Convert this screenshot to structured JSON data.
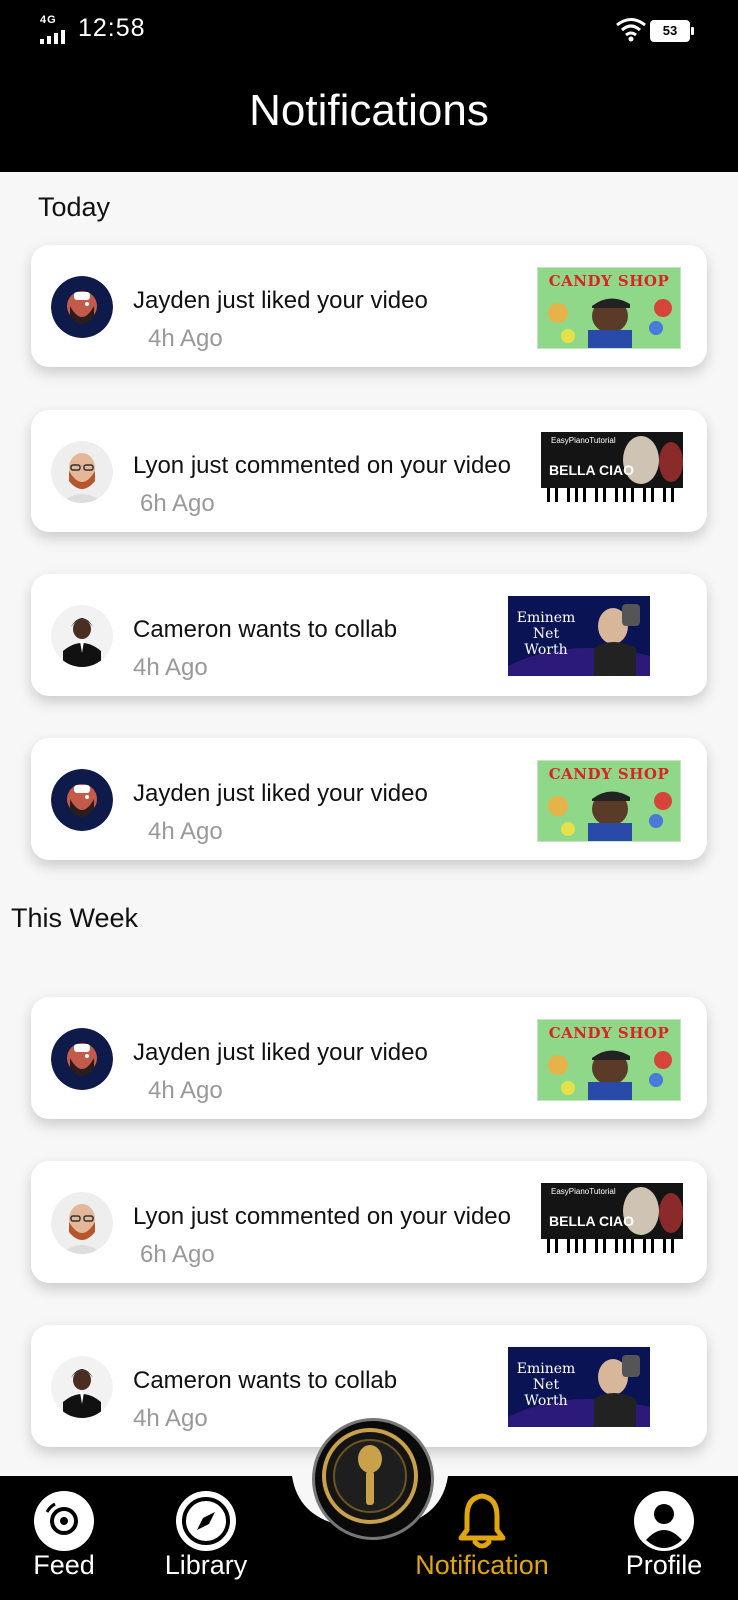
{
  "status_bar": {
    "network": "4G",
    "time": "12:58",
    "battery": "53"
  },
  "header": {
    "title": "Notifications"
  },
  "sections": [
    {
      "title": "Today",
      "items": [
        {
          "message": "Jayden just liked your video",
          "time": "4h Ago",
          "avatar": "bearded-man-illustration-avatar",
          "thumbnail": "candy-shop"
        },
        {
          "message": "Lyon just commented on your video",
          "time": "6h Ago",
          "avatar": "red-haired-man-photo-avatar",
          "thumbnail": "bella-ciao"
        },
        {
          "message": "Cameron wants to collab",
          "time": "4h Ago",
          "avatar": "man-in-suit-photo-avatar",
          "thumbnail": "eminem-net-worth"
        },
        {
          "message": "Jayden just liked your video",
          "time": "4h Ago",
          "avatar": "bearded-man-illustration-avatar",
          "thumbnail": "candy-shop"
        }
      ]
    },
    {
      "title": "This Week",
      "items": [
        {
          "message": "Jayden just liked your video",
          "time": "4h Ago",
          "avatar": "bearded-man-illustration-avatar",
          "thumbnail": "candy-shop"
        },
        {
          "message": "Lyon just commented on your video",
          "time": "6h Ago",
          "avatar": "red-haired-man-photo-avatar",
          "thumbnail": "bella-ciao"
        },
        {
          "message": "Cameron wants to collab",
          "time": "4h Ago",
          "avatar": "man-in-suit-photo-avatar",
          "thumbnail": "eminem-net-worth"
        }
      ]
    }
  ],
  "thumbnails": {
    "candy_shop": {
      "title": "CANDY SHOP"
    },
    "bella_ciao": {
      "channel": "EasyPianoTutorial",
      "title": "BELLA CIAO"
    },
    "eminem": {
      "line1": "Eminem",
      "line2": "Net",
      "line3": "Worth"
    }
  },
  "bottom_nav": {
    "items": [
      {
        "label": "Feed",
        "icon": "disc-icon"
      },
      {
        "label": "Library",
        "icon": "compass-icon"
      },
      {
        "label": "Notification",
        "icon": "bell-icon",
        "active": true
      },
      {
        "label": "Profile",
        "icon": "user-icon"
      }
    ],
    "center_icon": "microphone-icon"
  },
  "colors": {
    "header_bg": "#000000",
    "accent": "#e0a60d",
    "card_bg": "#ffffff",
    "muted_text": "#999999"
  }
}
